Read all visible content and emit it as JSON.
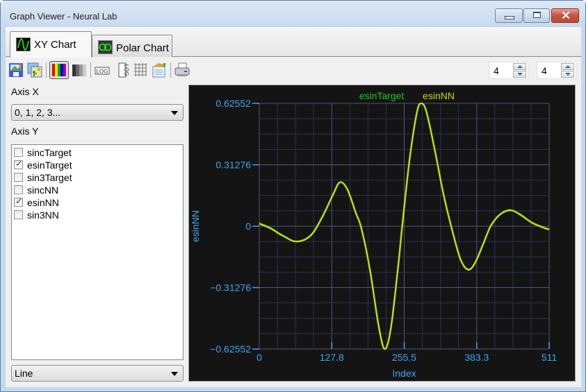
{
  "window": {
    "title": "Graph Viewer - Neural Lab",
    "controls": [
      "minimize",
      "maximize",
      "close"
    ]
  },
  "tabs": [
    {
      "label": "XY Chart",
      "icon": "sine-wave-icon",
      "active": true
    },
    {
      "label": "Polar Chart",
      "icon": "polar-chart-icon",
      "active": false
    }
  ],
  "toolbar": {
    "buttons": [
      {
        "name": "save-image-icon"
      },
      {
        "name": "copy-image-icon"
      },
      {
        "name": "color-palette-icon",
        "pressed": true
      },
      {
        "name": "grayscale-palette-icon"
      },
      {
        "name": "log-x-icon",
        "text": "LOG"
      },
      {
        "name": "log-y-icon",
        "text": "LOG"
      },
      {
        "name": "grid-icon"
      },
      {
        "name": "properties-icon"
      },
      {
        "name": "print-icon"
      }
    ],
    "spinners": [
      {
        "value": "4"
      },
      {
        "value": "4"
      }
    ]
  },
  "left_panel": {
    "axis_x_label": "Axis X",
    "axis_x_value": "0, 1, 2, 3...",
    "axis_y_label": "Axis Y",
    "series_list": [
      {
        "label": "sincTarget",
        "checked": false
      },
      {
        "label": "esinTarget",
        "checked": true
      },
      {
        "label": "sin3Target",
        "checked": false
      },
      {
        "label": "sincNN",
        "checked": false
      },
      {
        "label": "esinNN",
        "checked": true
      },
      {
        "label": "sin3NN",
        "checked": false
      }
    ],
    "plot_type": "Line"
  },
  "colors": {
    "axis": "#3ea6f0",
    "grid": "#2e2e5e",
    "background": "#141414",
    "esinTarget": "#1ec81e",
    "esinNN": "#d2d214"
  },
  "chart_data": {
    "type": "line",
    "title": "",
    "xlabel": "Index",
    "ylabel": "esinNN",
    "xlim": [
      0,
      511
    ],
    "ylim": [
      -0.62552,
      0.62552
    ],
    "xticks": [
      "0",
      "127.8",
      "255.5",
      "383.3",
      "511"
    ],
    "yticks": [
      "0.62552",
      "0.31276",
      "0",
      "−0.31276",
      "−0.62552"
    ],
    "xtick_values": [
      0,
      127.8,
      255.5,
      383.3,
      511
    ],
    "ytick_values": [
      0.62552,
      0.31276,
      0,
      -0.31276,
      -0.62552
    ],
    "grid": true,
    "legend": {
      "position": "top",
      "entries": [
        "esinTarget",
        "esinNN"
      ]
    },
    "series": [
      {
        "name": "esinTarget",
        "x": [
          0,
          20,
          40,
          65,
          90,
          110,
          130,
          142,
          155,
          170,
          180,
          195,
          210,
          221,
          232,
          245,
          252,
          265,
          278,
          286,
          295,
          310,
          325,
          341,
          355,
          368,
          380,
          395,
          408,
          425,
          443,
          460,
          480,
          500,
          511
        ],
        "y": [
          0.015,
          -0.01,
          -0.045,
          -0.078,
          -0.05,
          0.04,
          0.16,
          0.223,
          0.19,
          0.07,
          -0.01,
          -0.22,
          -0.5,
          -0.6255,
          -0.52,
          -0.2,
          0.0,
          0.34,
          0.58,
          0.6255,
          0.58,
          0.38,
          0.16,
          -0.03,
          -0.17,
          -0.22,
          -0.19,
          -0.09,
          0.0,
          0.06,
          0.08,
          0.06,
          0.02,
          -0.005,
          -0.016
        ]
      },
      {
        "name": "esinNN",
        "x": [
          0,
          20,
          40,
          65,
          90,
          110,
          130,
          142,
          155,
          170,
          180,
          195,
          210,
          221,
          232,
          245,
          252,
          265,
          278,
          286,
          295,
          310,
          325,
          341,
          355,
          368,
          380,
          395,
          408,
          425,
          443,
          460,
          480,
          500,
          511
        ],
        "y": [
          0.012,
          -0.012,
          -0.047,
          -0.078,
          -0.048,
          0.042,
          0.162,
          0.224,
          0.188,
          0.068,
          -0.012,
          -0.222,
          -0.502,
          -0.6255,
          -0.518,
          -0.198,
          0.002,
          0.342,
          0.582,
          0.6255,
          0.578,
          0.378,
          0.158,
          -0.032,
          -0.172,
          -0.222,
          -0.188,
          -0.088,
          0.002,
          0.062,
          0.082,
          0.058,
          0.018,
          -0.007,
          -0.018
        ]
      }
    ]
  }
}
